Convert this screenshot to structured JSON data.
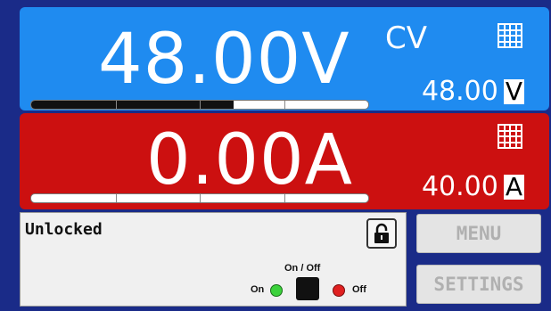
{
  "voltage": {
    "reading": "48.00V",
    "mode": "CV",
    "set_value": "48.00",
    "unit": "V",
    "bar_fraction": 0.6,
    "bar_color": "#111111",
    "icon": "keypad-icon"
  },
  "current": {
    "reading": "0.00A",
    "set_value": "40.00",
    "unit": "A",
    "bar_fraction": 0,
    "icon": "keypad-icon"
  },
  "status": {
    "text": "Unlocked",
    "lock_icon": "unlock-icon",
    "onoff_title": "On / Off",
    "on_label": "On",
    "off_label": "Off"
  },
  "buttons": {
    "menu": "MENU",
    "settings": "SETTINGS"
  },
  "colors": {
    "background": "#1a2b88",
    "voltage_panel": "#1f8bf0",
    "current_panel": "#cc1010",
    "on_led": "#3cd23c",
    "off_led": "#e02020"
  }
}
